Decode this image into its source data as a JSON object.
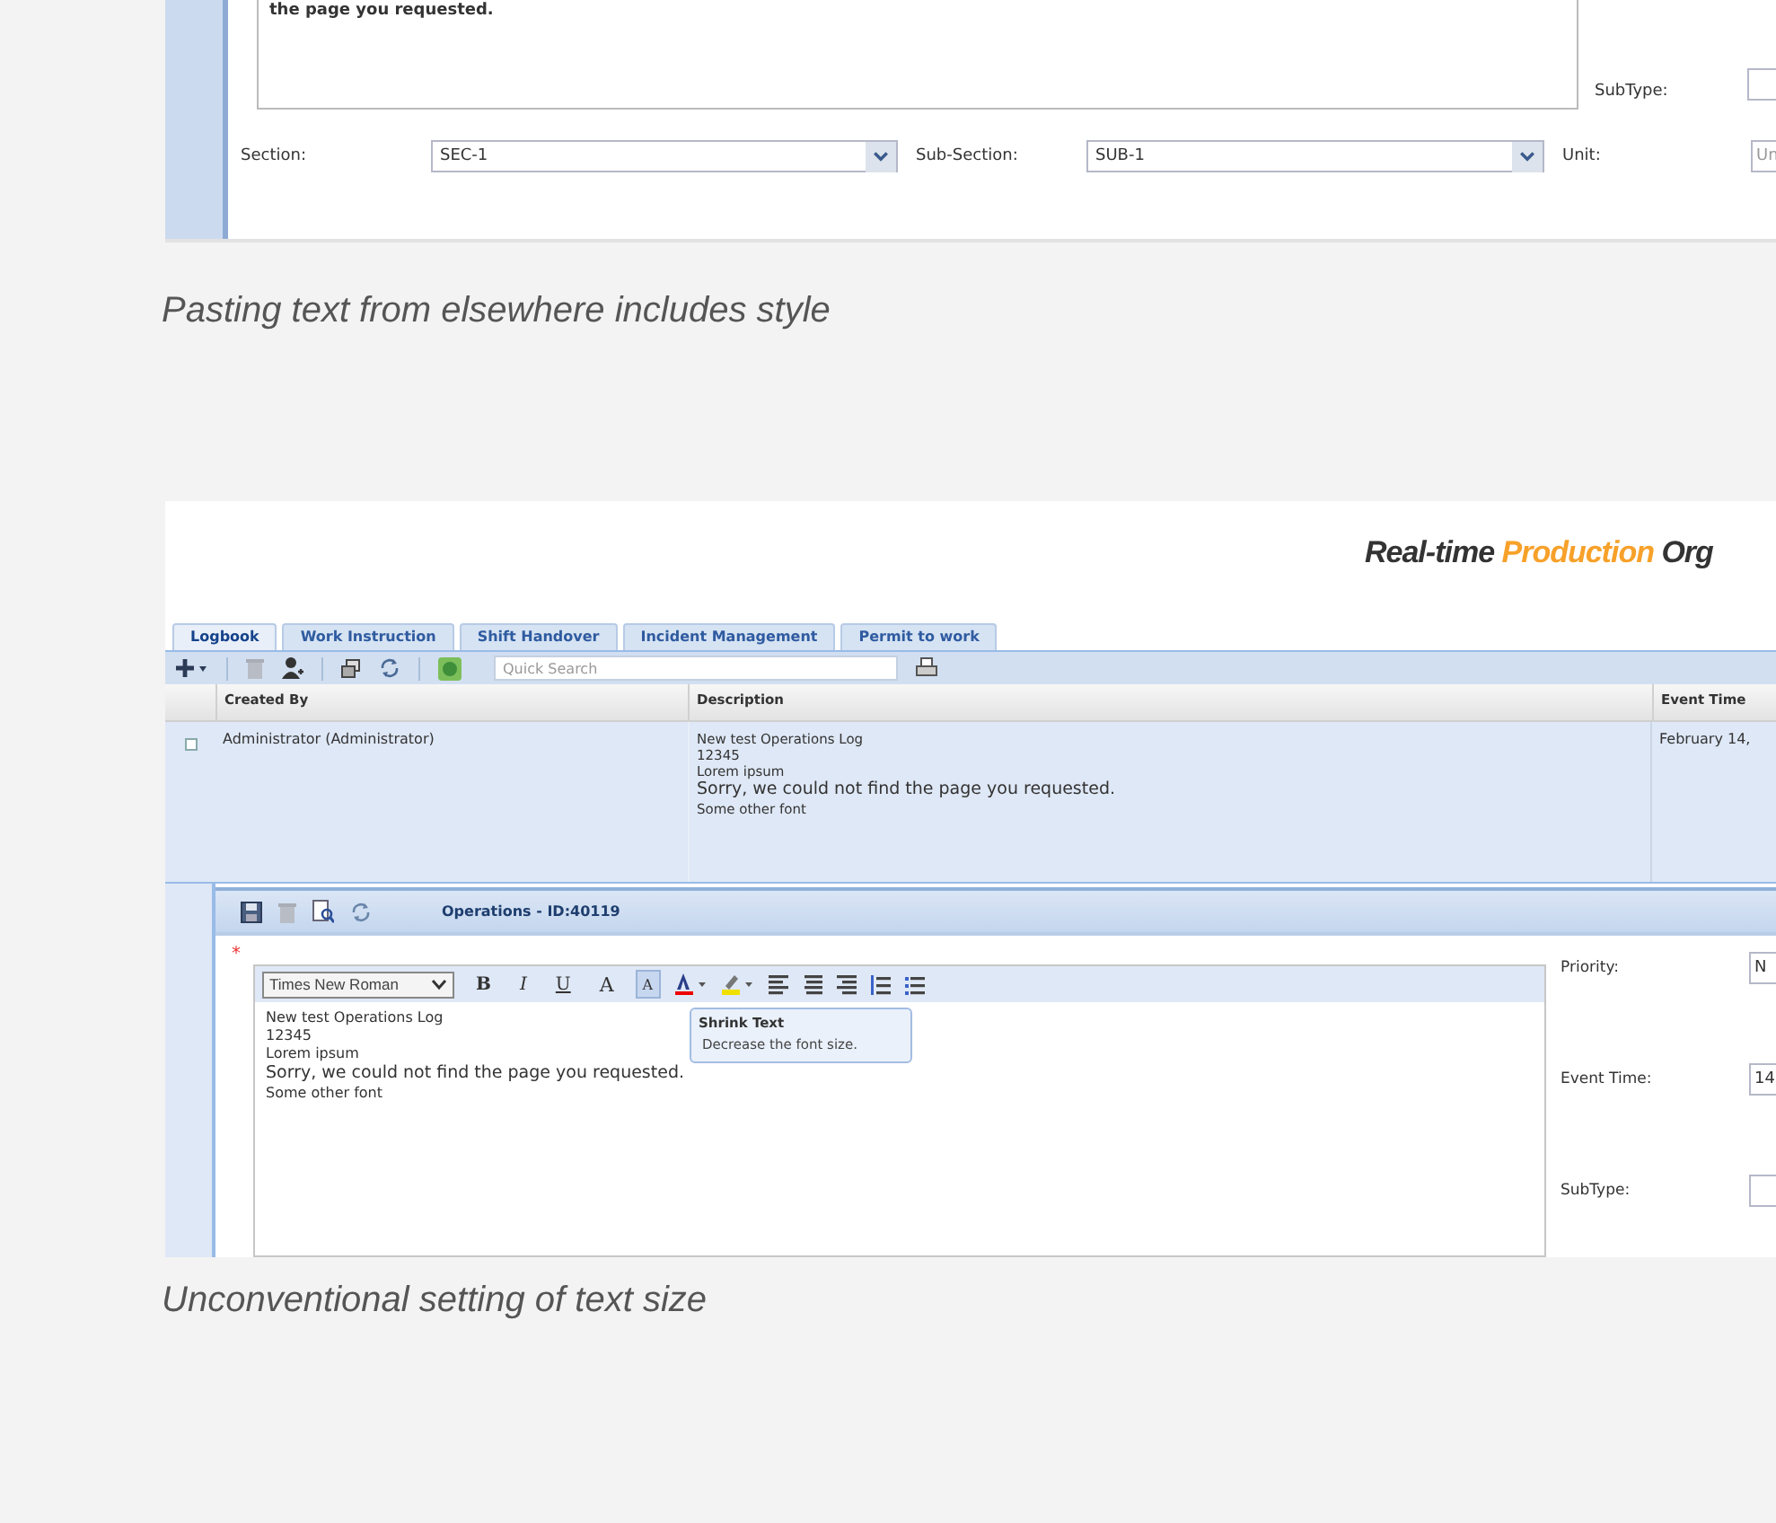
{
  "figure_top": {
    "editor_text": "the page you requested.",
    "side_field": {
      "label": "SubType:"
    },
    "fields": [
      {
        "label": "Section:",
        "value": "SEC-1",
        "kind": "select"
      },
      {
        "label": "Sub-Section:",
        "value": "SUB-1",
        "kind": "select"
      },
      {
        "label": "Unit:",
        "placeholder": "Un",
        "kind": "text"
      }
    ],
    "caption": "Pasting text from elsewhere includes style"
  },
  "figure_bottom": {
    "brand": [
      {
        "text": "Real-time ",
        "highlight": false
      },
      {
        "text": "Production",
        "highlight": true
      },
      {
        "text": " Org",
        "highlight": false
      }
    ],
    "tabs": [
      {
        "label": "Logbook",
        "selected": true
      },
      {
        "label": "Work Instruction",
        "selected": false
      },
      {
        "label": "Shift Handover",
        "selected": false
      },
      {
        "label": "Incident Management",
        "selected": false
      },
      {
        "label": "Permit to work",
        "selected": false
      }
    ],
    "search": {
      "placeholder": "Quick Search"
    },
    "table": {
      "columns": [
        "Created By",
        "Description",
        "Event Time"
      ],
      "rows": [
        {
          "created_by": "Administrator (Administrator)",
          "description": [
            {
              "text": "New test Operations Log",
              "kind": "normal"
            },
            {
              "text": "12345",
              "kind": "normal"
            },
            {
              "text": "Lorem ipsum",
              "kind": "normal"
            },
            {
              "text": "Sorry, we could not find the page you requested.",
              "kind": "large"
            },
            {
              "text": "Some other font",
              "kind": "normal"
            }
          ],
          "event_time": "February 14,"
        }
      ]
    },
    "detail": {
      "title": "Operations - ID:40119",
      "required_mark": "*",
      "font": "Times New Roman",
      "format_buttons": [
        {
          "label": "B",
          "kind": "bold",
          "active": false
        },
        {
          "label": "I",
          "kind": "italic",
          "active": false
        },
        {
          "label": "U",
          "kind": "underline",
          "active": false
        },
        {
          "label": "A",
          "kind": "grow",
          "active": false
        },
        {
          "label": "A",
          "kind": "shrink",
          "active": true
        }
      ],
      "editor_lines": [
        {
          "text": "New test Operations Log",
          "kind": "normal"
        },
        {
          "text": "12345",
          "kind": "normal"
        },
        {
          "text": "Lorem ipsum",
          "kind": "normal"
        },
        {
          "text": "Sorry, we could not find the page you requested.",
          "kind": "large"
        },
        {
          "text": "Some other font",
          "kind": "normal"
        }
      ],
      "tooltip": {
        "title": "Shrink Text",
        "text": "Decrease the font size."
      },
      "form": [
        {
          "label": "Priority:",
          "value": "N"
        },
        {
          "label": "Event Time:",
          "value": "14"
        },
        {
          "label": "SubType:"
        }
      ]
    },
    "caption": "Unconventional setting of text size"
  }
}
